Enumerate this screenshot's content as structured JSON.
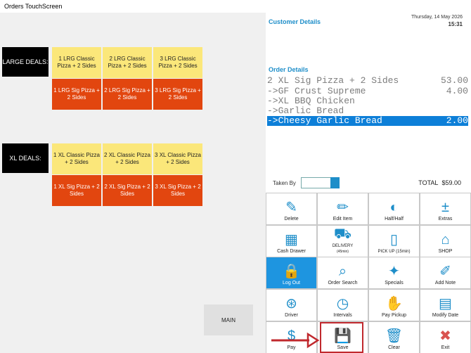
{
  "window": {
    "title": "Orders TouchScreen"
  },
  "menu": {
    "large_label": "LARGE DEALS:",
    "xl_label": "XL DEALS:",
    "large_deals": [
      "1 LRG Classic Pizza + 2 Sides",
      "2 LRG Classic Pizza + 2 Sides",
      "3 LRG Classic Pizza + 2 Sides",
      "1 LRG Sig Pizza + 2 Sides",
      "2 LRG Sig Pizza + 2 Sides",
      "3 LRG Sig Pizza + 2 Sides"
    ],
    "xl_deals": [
      "1 XL Classic Pizza + 2 Sides",
      "2 XL Classic Pizza + 2 Sides",
      "3 XL Classic Pizza + 2 Sides",
      "1 XL Sig Pizza + 2 Sides",
      "2 XL Sig Pizza + 2 Sides",
      "3 XL Sig Pizza + 2 Sides"
    ],
    "main_label": "MAIN"
  },
  "header": {
    "date": "Thursday, 14 May 2026",
    "time": "15:31"
  },
  "customer": {
    "heading": "Customer Details"
  },
  "order": {
    "heading": "Order Details",
    "lines": [
      {
        "text": "2 XL Sig Pizza + 2 Sides",
        "price": "53.00"
      },
      {
        "text": "->GF Crust Supreme",
        "price": "4.00"
      },
      {
        "text": "->XL BBQ Chicken",
        "price": ""
      },
      {
        "text": "->Garlic Bread",
        "price": ""
      },
      {
        "text": "->Cheesy Garlic Bread",
        "price": "2.00"
      }
    ],
    "selected_index": 4
  },
  "taken_by": {
    "label": "Taken By",
    "value": ""
  },
  "total": {
    "label": "TOTAL",
    "value": "$59.00"
  },
  "actions": {
    "delete": "Delete",
    "edit_item": "Edit Item",
    "half_half": "Half/Half",
    "extras": "Extras",
    "cash_drawer": "Cash Drawer",
    "delivery": "DELIVERY",
    "delivery_sub": "(45min)",
    "pick_up": "PICK UP (15min)",
    "shop": "SHOP",
    "log_out": "Log Out",
    "order_search": "Order Search",
    "specials": "Specials",
    "add_note": "Add Note",
    "driver": "Driver",
    "intervals": "Intervals",
    "pay_pickup": "Pay Pickup",
    "modify_date": "Modify Date",
    "pay": "Pay",
    "save": "Save",
    "clear": "Clear",
    "exit": "Exit"
  },
  "colors": {
    "accent": "#1e8ec9",
    "deal_yellow": "#fbe77a",
    "deal_orange": "#e2460f",
    "selected_row": "#0d7fd8",
    "highlight": "#c0282d"
  }
}
